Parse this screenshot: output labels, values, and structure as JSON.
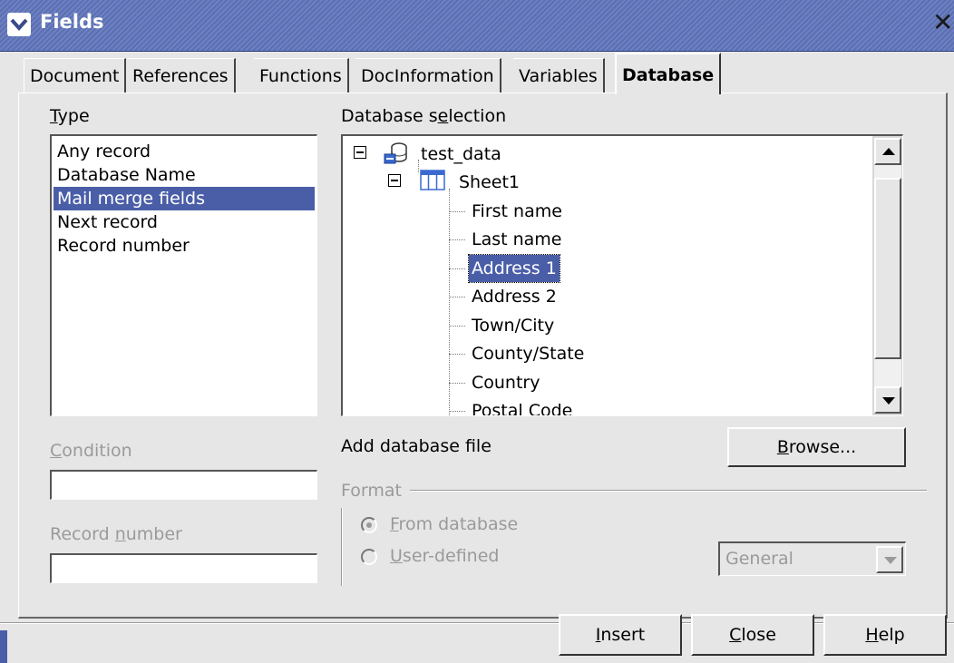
{
  "window": {
    "title": "Fields"
  },
  "tabs": [
    {
      "label": "Document"
    },
    {
      "label": "References"
    },
    {
      "label": "Functions"
    },
    {
      "label": "DocInformation"
    },
    {
      "label": "Variables"
    },
    {
      "label": "Database"
    }
  ],
  "type_section": {
    "label_u": "T",
    "label_rest": "ype",
    "items": [
      "Any record",
      "Database Name",
      "Mail merge fields",
      "Next record",
      "Record number"
    ],
    "selected": "Mail merge fields"
  },
  "db_selection": {
    "label_pre": "Database s",
    "label_u": "e",
    "label_post": "lection",
    "database": "test_data",
    "table": "Sheet1",
    "fields": [
      "First name",
      "Last name",
      "Address 1",
      "Address 2",
      "Town/City",
      "County/State",
      "Country",
      "Postal Code"
    ],
    "selected_field": "Address 1"
  },
  "condition": {
    "label_u": "C",
    "label_rest": "ondition",
    "value": ""
  },
  "record_number": {
    "label_pre": "Record ",
    "label_u": "n",
    "label_post": "umber",
    "value": ""
  },
  "add_db": {
    "label": "Add database file",
    "browse_u": "B",
    "browse_rest": "rowse..."
  },
  "format": {
    "label": "Format",
    "from_db_u": "F",
    "from_db_rest": "rom database",
    "user_def_u": "U",
    "user_def_rest": "ser-defined",
    "select_value": "General"
  },
  "footer": {
    "insert_u": "I",
    "insert_rest": "nsert",
    "close_u": "C",
    "close_rest": "lose",
    "help_u": "H",
    "help_rest": "elp"
  }
}
